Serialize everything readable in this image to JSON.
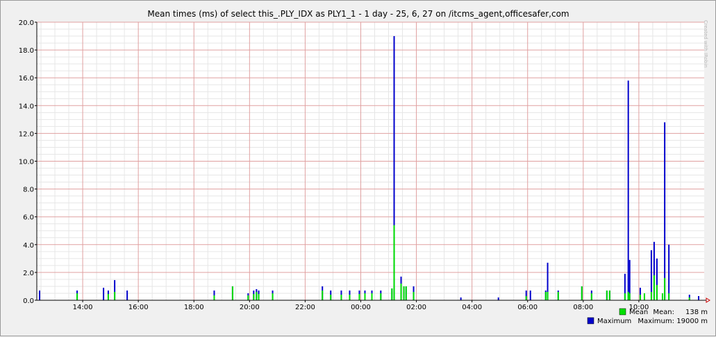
{
  "chart_data": {
    "type": "bar",
    "title": "Mean times (ms) of select this_.PLY_IDX as PLY1_1 - 1 day - 25, 6, 27 on /itcms_agent,officesafer,com",
    "watermark": "Created with JRobin",
    "xlabel": "",
    "ylabel": "",
    "ylim": [
      0,
      20
    ],
    "y_ticks": [
      "0.0",
      "2.0",
      "4.0",
      "6.0",
      "8.0",
      "10.0",
      "12.0",
      "14.0",
      "16.0",
      "18.0",
      "20.0"
    ],
    "x_ticks": [
      "14:00",
      "16:00",
      "18:00",
      "20:00",
      "22:00",
      "00:00",
      "02:00",
      "04:00",
      "06:00",
      "08:00",
      "10:00"
    ],
    "x_unit": "hours since 14:00",
    "x_range": [
      -1.65,
      22.35
    ],
    "grid": true,
    "legend_position": "bottom-right",
    "colors": {
      "mean": "#00e000",
      "maximum": "#0000cc",
      "grid_major": "#e0a0a0",
      "grid_minor": "#e6e6e6",
      "axis": "#000000",
      "plot_bg": "#ffffff"
    },
    "series": [
      {
        "name": "Mean",
        "stat_label": "Mean:",
        "stat_value": "138 m",
        "points": [
          [
            -0.2,
            0.5
          ],
          [
            0.92,
            0.45
          ],
          [
            1.15,
            0.6
          ],
          [
            4.73,
            0.35
          ],
          [
            5.39,
            1.0
          ],
          [
            5.95,
            0.35
          ],
          [
            6.15,
            0.45
          ],
          [
            6.25,
            0.6
          ],
          [
            6.33,
            0.45
          ],
          [
            6.83,
            0.5
          ],
          [
            8.62,
            0.7
          ],
          [
            8.92,
            0.4
          ],
          [
            9.3,
            0.4
          ],
          [
            9.6,
            0.4
          ],
          [
            9.95,
            0.45
          ],
          [
            10.15,
            0.5
          ],
          [
            10.4,
            0.5
          ],
          [
            10.72,
            0.5
          ],
          [
            11.12,
            0.85
          ],
          [
            11.2,
            5.4
          ],
          [
            11.45,
            1.2
          ],
          [
            11.55,
            1.0
          ],
          [
            11.63,
            1.0
          ],
          [
            11.9,
            0.6
          ],
          [
            15.95,
            0.3
          ],
          [
            16.65,
            0.6
          ],
          [
            16.72,
            0.6
          ],
          [
            17.1,
            0.6
          ],
          [
            17.95,
            1.0
          ],
          [
            18.3,
            0.5
          ],
          [
            18.85,
            0.7
          ],
          [
            18.95,
            0.7
          ],
          [
            19.5,
            0.5
          ],
          [
            19.62,
            0.6
          ],
          [
            19.67,
            0.5
          ],
          [
            20.05,
            0.4
          ],
          [
            20.2,
            0.5
          ],
          [
            20.45,
            0.6
          ],
          [
            20.55,
            1.8
          ],
          [
            20.65,
            1.1
          ],
          [
            20.85,
            0.5
          ],
          [
            20.93,
            1.6
          ],
          [
            21.08,
            0.5
          ],
          [
            21.82,
            0.2
          ]
        ]
      },
      {
        "name": "Maximum",
        "stat_label": "Maximum:",
        "stat_value": "19000 m",
        "points": [
          [
            -1.55,
            0.7
          ],
          [
            -0.2,
            0.7
          ],
          [
            0.75,
            0.9
          ],
          [
            0.92,
            0.7
          ],
          [
            1.15,
            1.45
          ],
          [
            1.6,
            0.7
          ],
          [
            4.73,
            0.7
          ],
          [
            5.39,
            1.0
          ],
          [
            5.95,
            0.5
          ],
          [
            6.15,
            0.7
          ],
          [
            6.25,
            0.8
          ],
          [
            6.33,
            0.7
          ],
          [
            6.83,
            0.7
          ],
          [
            8.62,
            1.0
          ],
          [
            8.92,
            0.7
          ],
          [
            9.3,
            0.7
          ],
          [
            9.6,
            0.7
          ],
          [
            9.95,
            0.7
          ],
          [
            10.15,
            0.7
          ],
          [
            10.4,
            0.7
          ],
          [
            10.72,
            0.7
          ],
          [
            11.12,
            0.85
          ],
          [
            11.2,
            19.0
          ],
          [
            11.45,
            1.7
          ],
          [
            11.55,
            1.0
          ],
          [
            11.63,
            1.0
          ],
          [
            11.9,
            1.0
          ],
          [
            13.6,
            0.2
          ],
          [
            14.95,
            0.2
          ],
          [
            15.95,
            0.7
          ],
          [
            16.1,
            0.7
          ],
          [
            16.65,
            0.7
          ],
          [
            16.72,
            2.7
          ],
          [
            17.1,
            0.7
          ],
          [
            17.95,
            1.0
          ],
          [
            18.3,
            0.7
          ],
          [
            18.85,
            0.7
          ],
          [
            18.95,
            0.7
          ],
          [
            19.5,
            1.9
          ],
          [
            19.62,
            15.8
          ],
          [
            19.67,
            2.9
          ],
          [
            20.05,
            0.9
          ],
          [
            20.45,
            3.6
          ],
          [
            20.55,
            4.2
          ],
          [
            20.65,
            3.0
          ],
          [
            20.93,
            12.8
          ],
          [
            21.08,
            4.0
          ],
          [
            21.82,
            0.4
          ],
          [
            22.15,
            0.3
          ]
        ]
      }
    ]
  }
}
